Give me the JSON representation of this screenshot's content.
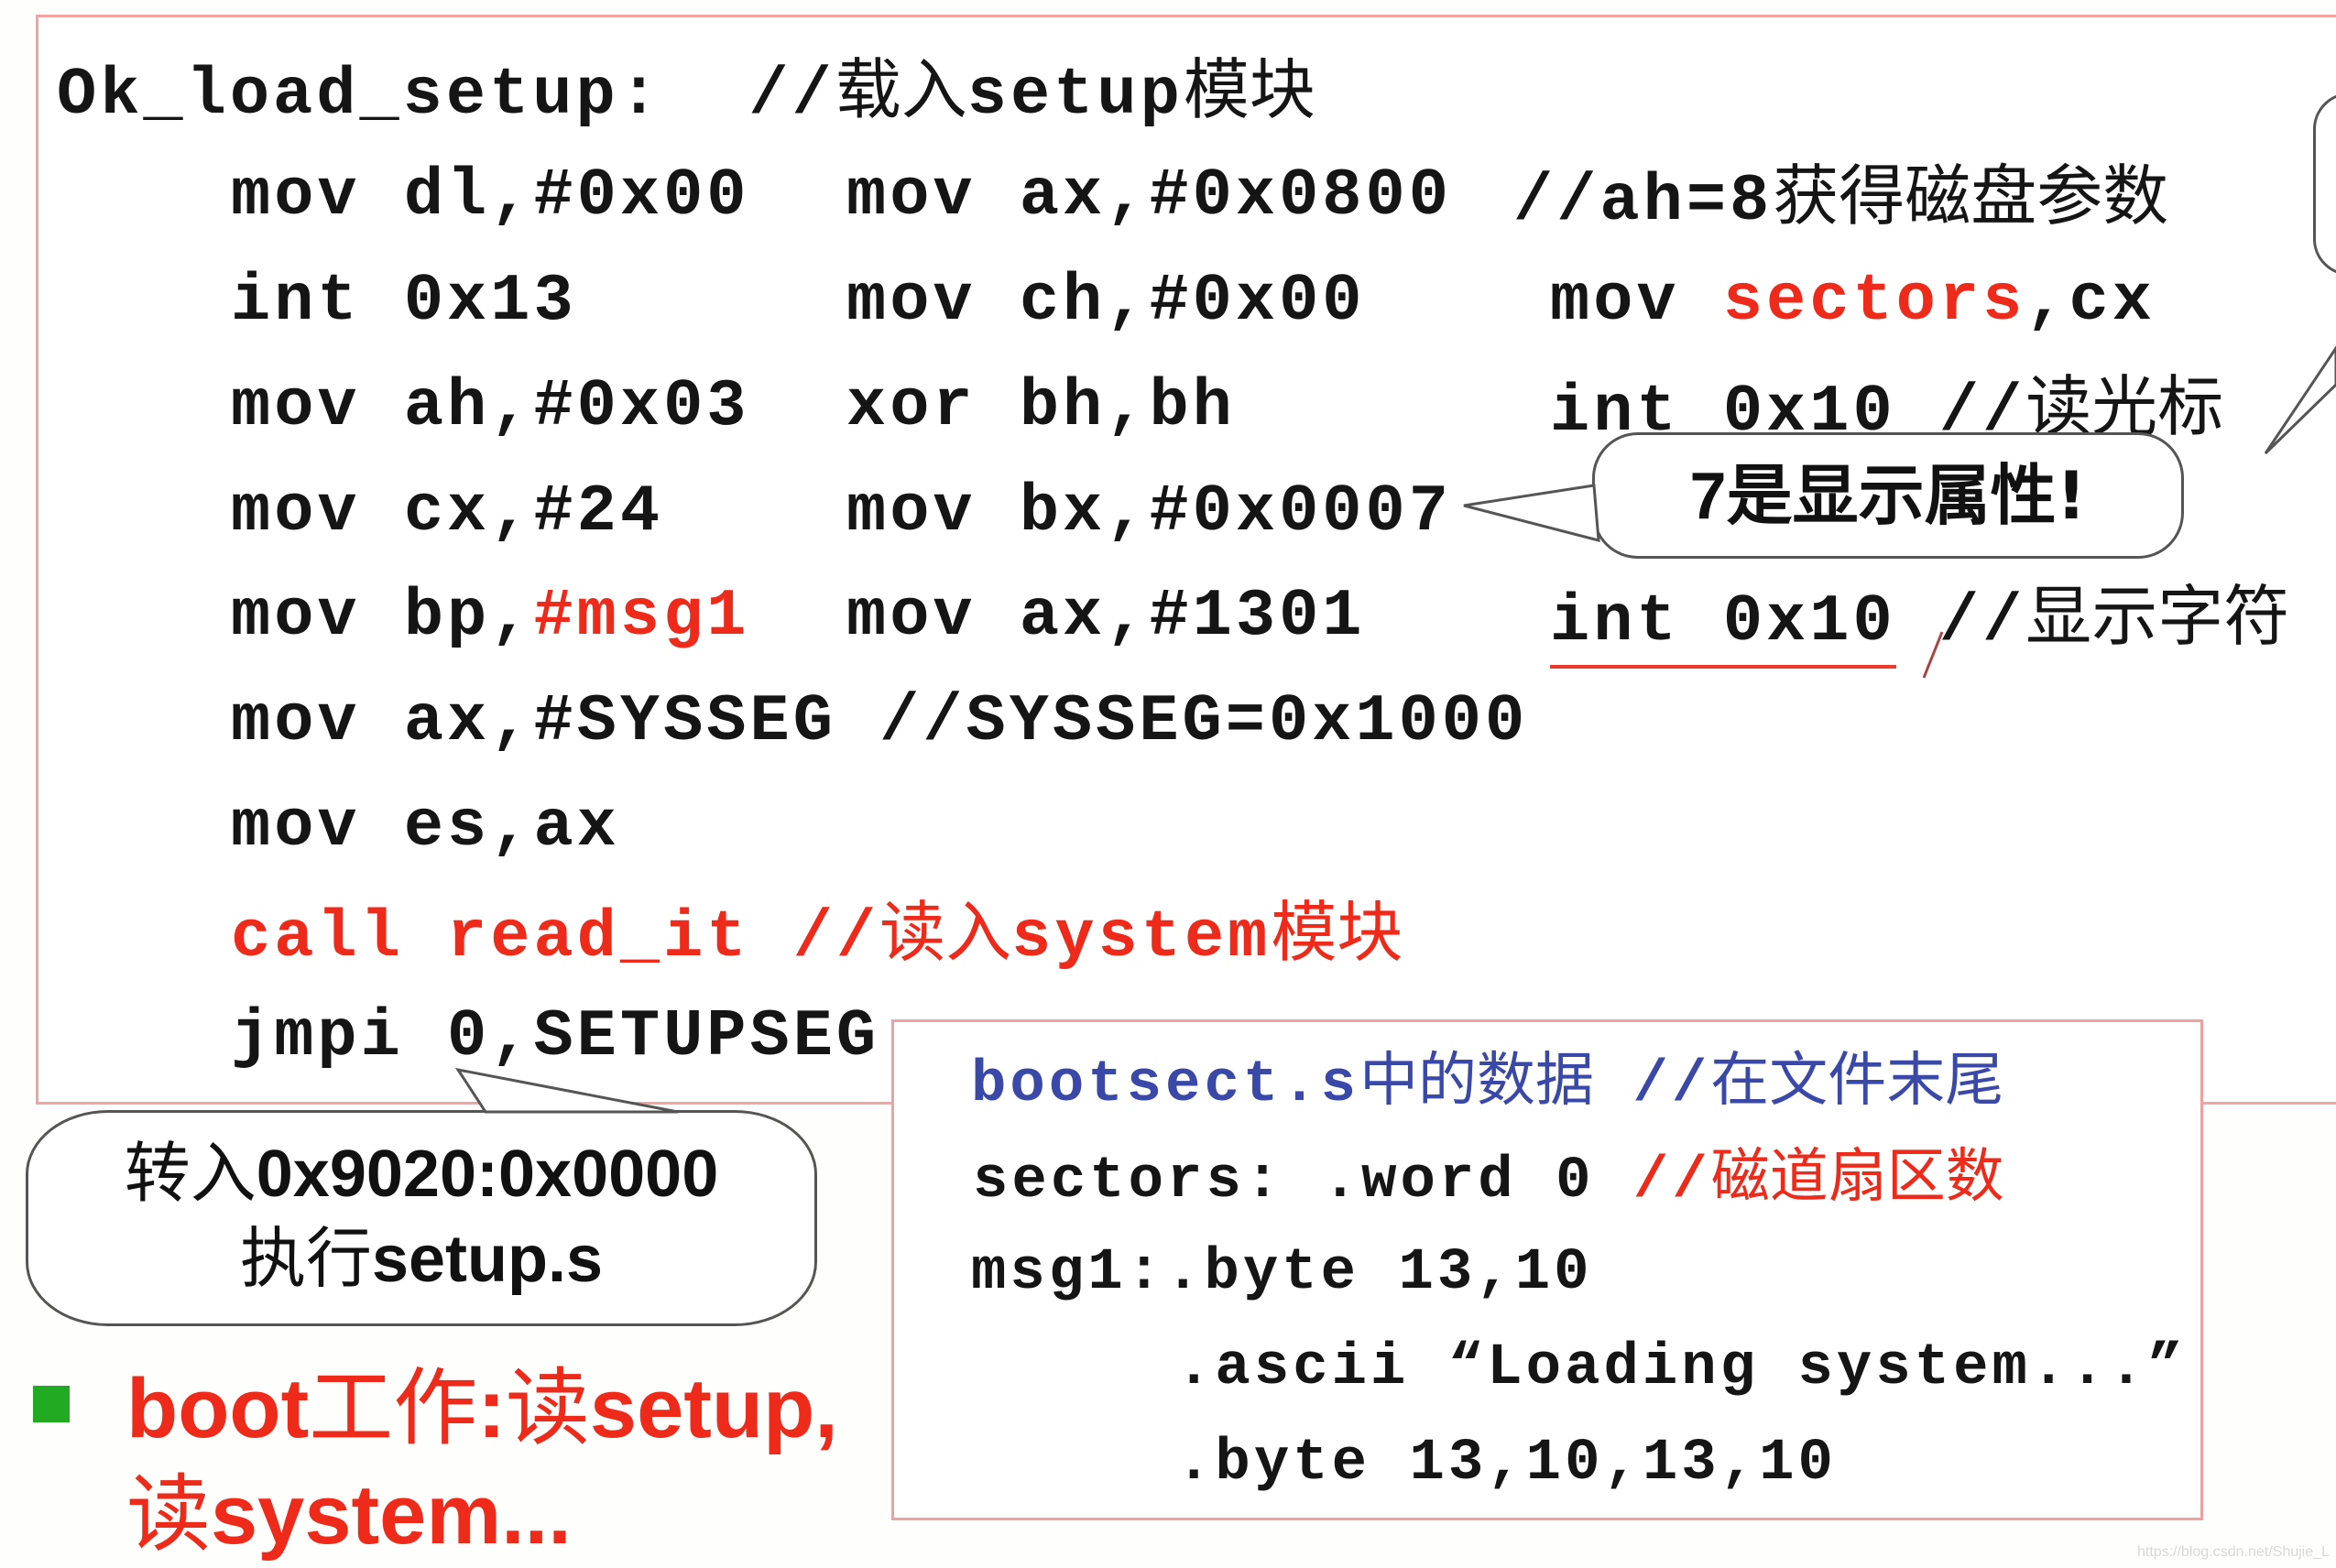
{
  "code_block": {
    "label_line": {
      "label": "Ok_load_setup:",
      "comment_prefix": "//",
      "comment_cjk_1": "载入",
      "comment_latin": "setup",
      "comment_cjk_2": "模块"
    },
    "rows": [
      {
        "c1": "mov dl,#0x00",
        "c2": "mov ax,#0x0800",
        "c3_code": "//ah=8",
        "c3_cjk": "获得磁盘参数"
      },
      {
        "c1": "int 0x13",
        "c2": "mov ch,#0x00",
        "c3_pre": "mov ",
        "c3_red": "sectors",
        "c3_post": ",cx"
      },
      {
        "c1": "mov ah,#0x03",
        "c2": "xor bh,bh",
        "c3_code": "int 0x10 //",
        "c3_cjk": "读光标"
      },
      {
        "c1": "mov cx,#24",
        "c2": "mov bx,#0x0007"
      },
      {
        "c1_pre": "mov bp,",
        "c1_red": "#msg1",
        "c2": "mov ax,#1301",
        "c3_code": "int 0x10",
        "c3_comment": " //",
        "c3_cjk": "显示字符"
      },
      {
        "full": "mov ax,#SYSSEG //SYSSEG=0x1000"
      },
      {
        "full": "mov es,ax"
      },
      {
        "red_code": "call read_it //",
        "red_cjk_1": "读入",
        "red_latin": "system",
        "red_cjk_2": "模块"
      },
      {
        "full": "jmpi 0,SETUPSEG"
      }
    ]
  },
  "callouts": {
    "attr": {
      "num": "7",
      "text": "是显示属性!"
    },
    "jump": {
      "line1_cjk": "转入",
      "line1_latin": "0x9020:0x0000",
      "line2_cjk": "执行",
      "line2_latin": "setup.s"
    }
  },
  "data_box": {
    "title_latin": "bootsect.s",
    "title_cjk": "中的数据",
    "title_comment": " //",
    "title_comment_cjk": "在文件末尾",
    "sectors_line": "sectors: .word 0 ",
    "sectors_comment": "//",
    "sectors_comment_cjk": "磁道扇区数",
    "msg1_line": "msg1:.byte 13,10",
    "ascii_line": ".ascii “Loading system...”",
    "byte_line": ".byte 13,10,13,10"
  },
  "bullet": {
    "line1_a": "boot",
    "line1_b": "工作",
    "line1_c": ":",
    "line1_d": "读",
    "line1_e": "setup,",
    "line2_a": "读",
    "line2_b": "system..."
  },
  "watermark": "https://blog.csdn.net/Shujie_L",
  "colors": {
    "accent_red": "#ee2a1a",
    "box_border": "#f3a3a3",
    "title_blue": "#3a48a8",
    "bullet_green": "#22aa22"
  }
}
